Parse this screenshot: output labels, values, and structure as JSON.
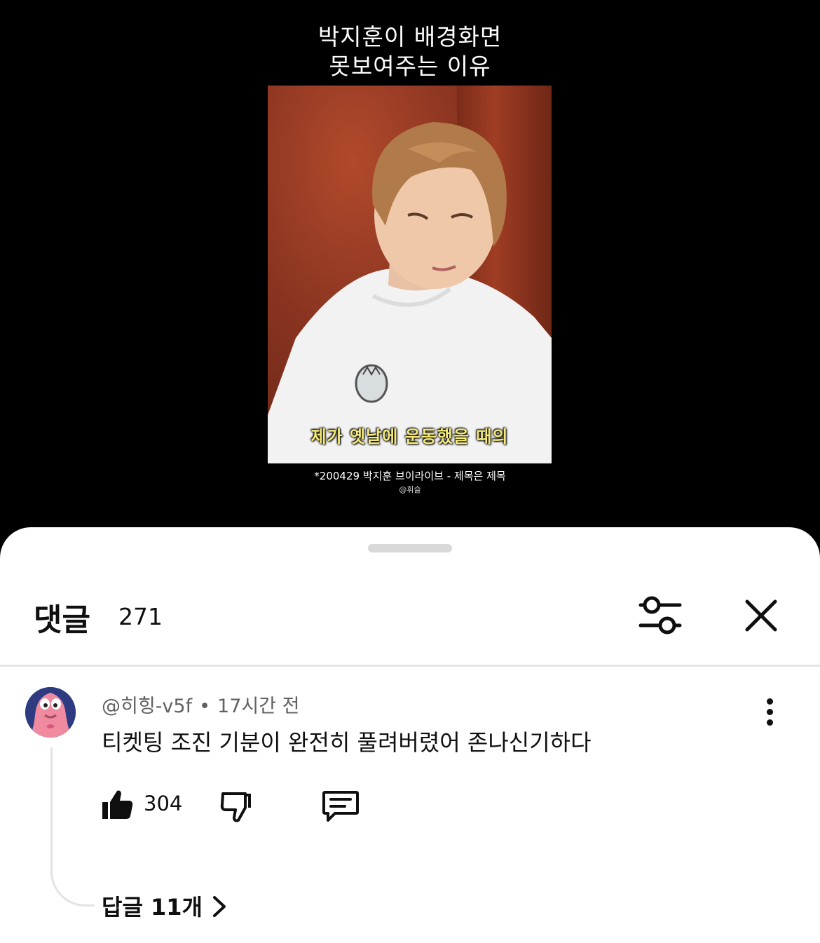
{
  "video": {
    "title_line1": "박지훈이 배경화면",
    "title_line2": "못보여주는 이유",
    "subtitle": "제가 옛날에 운동했을 때의",
    "credit": "*200429 박지훈 브이라이브 - 제목은 제목",
    "credit2": "@휘슬"
  },
  "comments": {
    "title": "댓글",
    "count": "271",
    "filter_icon": "sliders-icon",
    "close_icon": "close-icon"
  },
  "comment": {
    "author": "@히힝-v5f",
    "separator": "•",
    "time": "17시간 전",
    "text": "티켓팅 조진 기분이 완전히 풀려버렸어 존나신기하다",
    "likes": "304",
    "replies_label": "답글 11개"
  },
  "colors": {
    "sheet_bg": "#ffffff",
    "text_primary": "#0f0f0f",
    "text_secondary": "#606060",
    "subtitle_yellow": "#f4e97a"
  }
}
